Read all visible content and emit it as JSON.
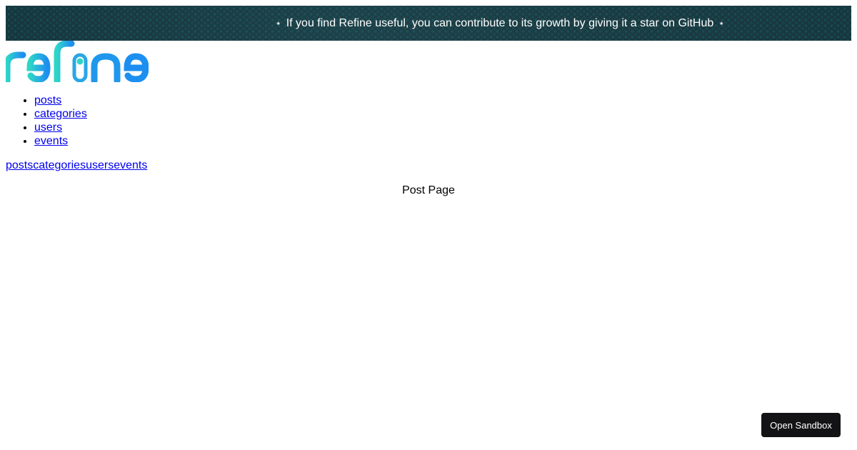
{
  "banner": {
    "text": "If you find Refine useful, you can contribute to its growth by giving it a star on GitHub",
    "star_left": "⭑",
    "star_right": "⭑",
    "bg_color": "#1d3d44"
  },
  "logo": {
    "text": "refine",
    "colors": [
      "#2ed5c7",
      "#2ba6e6",
      "#1d8ff0"
    ]
  },
  "nav_list": {
    "items": [
      {
        "label": "posts"
      },
      {
        "label": "categories"
      },
      {
        "label": "users"
      },
      {
        "label": "events"
      }
    ]
  },
  "inline_nav": {
    "items": [
      {
        "label": "posts"
      },
      {
        "label": "categories"
      },
      {
        "label": "users"
      },
      {
        "label": "events"
      }
    ]
  },
  "main": {
    "title": "Post Page"
  },
  "sandbox": {
    "label": "Open Sandbox"
  }
}
